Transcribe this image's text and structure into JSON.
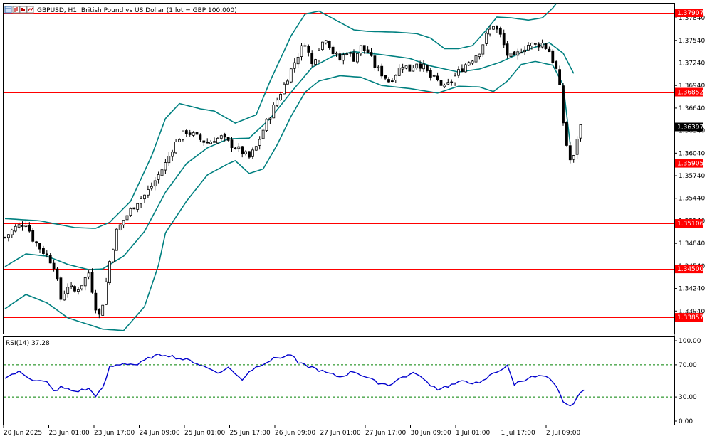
{
  "header": {
    "title": "GBPUSD, H1:  British Pound vs US Dollar (1 lot = GBP 100,000)",
    "icon_names": [
      "window-icon",
      "bars-icon",
      "candles-icon",
      "line-icon"
    ]
  },
  "indicator": {
    "label": "RSI(14) 37.28",
    "value": 37.28
  },
  "colors": {
    "candle": "#000000",
    "bollinger": "#008080",
    "level_line": "#ff0000",
    "level_tag": "#ff0000",
    "current_line": "#000000",
    "current_tag": "#000000",
    "rsi_line": "#0000cd",
    "rsi_levels": "#008000",
    "grid_frame": "#000000"
  },
  "chart_data": {
    "type": "candlestick",
    "symbol": "GBPUSD",
    "timeframe": "H1",
    "price_axis_ticks": [
      "1.37840",
      "1.37540",
      "1.37240",
      "1.36940",
      "1.36640",
      "1.36340",
      "1.36040",
      "1.35740",
      "1.35440",
      "1.35140",
      "1.34840",
      "1.34540",
      "1.34240",
      "1.33940"
    ],
    "ylim": [
      1.3364,
      1.3803
    ],
    "horizontal_levels": [
      {
        "label": "1.37907",
        "value": 1.37907
      },
      {
        "label": "1.36852",
        "value": 1.36852
      },
      {
        "label": "1.35905",
        "value": 1.35905
      },
      {
        "label": "1.35106",
        "value": 1.35106
      },
      {
        "label": "1.34500",
        "value": 1.345
      },
      {
        "label": "1.33857",
        "value": 1.33857
      }
    ],
    "current_price": {
      "label": "1.36397",
      "value": 1.36397
    },
    "time_labels": [
      "20 Jun 2025",
      "23 Jun 01:00",
      "23 Jun 17:00",
      "24 Jun 09:00",
      "25 Jun 01:00",
      "25 Jun 17:00",
      "26 Jun 09:00",
      "27 Jun 01:00",
      "27 Jun 17:00",
      "30 Jun 09:00",
      "1 Jul 01:00",
      "1 Jul 17:00",
      "2 Jul 09:00"
    ],
    "close_path": [
      [
        0,
        1.3492
      ],
      [
        3,
        1.3505
      ],
      [
        6,
        1.3512
      ],
      [
        8,
        1.349
      ],
      [
        10,
        1.3478
      ],
      [
        12,
        1.3468
      ],
      [
        14,
        1.3455
      ],
      [
        16,
        1.341
      ],
      [
        18,
        1.3428
      ],
      [
        20,
        1.342
      ],
      [
        22,
        1.343
      ],
      [
        24,
        1.3445
      ],
      [
        26,
        1.34
      ],
      [
        27,
        1.3388
      ],
      [
        28,
        1.3405
      ],
      [
        30,
        1.346
      ],
      [
        32,
        1.35
      ],
      [
        34,
        1.3515
      ],
      [
        36,
        1.3528
      ],
      [
        38,
        1.354
      ],
      [
        40,
        1.3548
      ],
      [
        42,
        1.356
      ],
      [
        44,
        1.3575
      ],
      [
        46,
        1.359
      ],
      [
        48,
        1.361
      ],
      [
        50,
        1.3625
      ],
      [
        52,
        1.3633
      ],
      [
        54,
        1.3628
      ],
      [
        56,
        1.3622
      ],
      [
        58,
        1.3618
      ],
      [
        60,
        1.3622
      ],
      [
        62,
        1.3625
      ],
      [
        64,
        1.3618
      ],
      [
        66,
        1.3612
      ],
      [
        68,
        1.3605
      ],
      [
        70,
        1.3598
      ],
      [
        72,
        1.3612
      ],
      [
        74,
        1.3635
      ],
      [
        76,
        1.3655
      ],
      [
        78,
        1.3675
      ],
      [
        80,
        1.3695
      ],
      [
        82,
        1.3715
      ],
      [
        84,
        1.3735
      ],
      [
        86,
        1.3752
      ],
      [
        88,
        1.3722
      ],
      [
        90,
        1.3745
      ],
      [
        92,
        1.3758
      ],
      [
        94,
        1.3738
      ],
      [
        96,
        1.3728
      ],
      [
        98,
        1.374
      ],
      [
        100,
        1.373
      ],
      [
        102,
        1.3745
      ],
      [
        104,
        1.3738
      ],
      [
        106,
        1.372
      ],
      [
        108,
        1.371
      ],
      [
        110,
        1.37
      ],
      [
        112,
        1.371
      ],
      [
        114,
        1.3722
      ],
      [
        116,
        1.3715
      ],
      [
        118,
        1.3725
      ],
      [
        120,
        1.3718
      ],
      [
        122,
        1.3705
      ],
      [
        124,
        1.37
      ],
      [
        126,
        1.369
      ],
      [
        128,
        1.37
      ],
      [
        130,
        1.3712
      ],
      [
        132,
        1.3722
      ],
      [
        134,
        1.373
      ],
      [
        136,
        1.374
      ],
      [
        138,
        1.376
      ],
      [
        140,
        1.3775
      ],
      [
        142,
        1.376
      ],
      [
        144,
        1.3735
      ],
      [
        146,
        1.373
      ],
      [
        148,
        1.3742
      ],
      [
        150,
        1.3748
      ],
      [
        152,
        1.3748
      ],
      [
        154,
        1.375
      ],
      [
        156,
        1.374
      ],
      [
        158,
        1.3715
      ],
      [
        159,
        1.369
      ],
      [
        160,
        1.3645
      ],
      [
        161,
        1.3615
      ],
      [
        162,
        1.3595
      ],
      [
        163,
        1.3598
      ],
      [
        164,
        1.3625
      ],
      [
        165,
        1.364
      ]
    ],
    "bollinger_bands": {
      "period_note": "upper / middle / lower bands",
      "upper": [
        [
          0,
          1.3517
        ],
        [
          10,
          1.3514
        ],
        [
          20,
          1.3505
        ],
        [
          26,
          1.3504
        ],
        [
          30,
          1.3512
        ],
        [
          36,
          1.354
        ],
        [
          42,
          1.36
        ],
        [
          46,
          1.365
        ],
        [
          50,
          1.367
        ],
        [
          56,
          1.3663
        ],
        [
          60,
          1.366
        ],
        [
          66,
          1.3644
        ],
        [
          72,
          1.3655
        ],
        [
          76,
          1.37
        ],
        [
          82,
          1.376
        ],
        [
          86,
          1.3789
        ],
        [
          90,
          1.3793
        ],
        [
          96,
          1.3778
        ],
        [
          100,
          1.3768
        ],
        [
          104,
          1.3766
        ],
        [
          112,
          1.3765
        ],
        [
          118,
          1.3763
        ],
        [
          122,
          1.3757
        ],
        [
          126,
          1.3743
        ],
        [
          130,
          1.3743
        ],
        [
          134,
          1.3747
        ],
        [
          138,
          1.3768
        ],
        [
          141,
          1.3785
        ],
        [
          145,
          1.3784
        ],
        [
          150,
          1.3781
        ],
        [
          154,
          1.3784
        ],
        [
          157,
          1.3797
        ],
        [
          158,
          1.381
        ]
      ],
      "middle": [
        [
          0,
          1.3453
        ],
        [
          6,
          1.347
        ],
        [
          12,
          1.3467
        ],
        [
          18,
          1.3456
        ],
        [
          24,
          1.3449
        ],
        [
          28,
          1.345
        ],
        [
          34,
          1.3467
        ],
        [
          40,
          1.35
        ],
        [
          46,
          1.3552
        ],
        [
          52,
          1.359
        ],
        [
          58,
          1.3611
        ],
        [
          64,
          1.3623
        ],
        [
          70,
          1.3624
        ],
        [
          76,
          1.365
        ],
        [
          82,
          1.3685
        ],
        [
          88,
          1.3718
        ],
        [
          94,
          1.3733
        ],
        [
          100,
          1.3739
        ],
        [
          108,
          1.3735
        ],
        [
          116,
          1.373
        ],
        [
          122,
          1.372
        ],
        [
          130,
          1.3712
        ],
        [
          136,
          1.3716
        ],
        [
          142,
          1.3725
        ],
        [
          150,
          1.3742
        ],
        [
          156,
          1.3751
        ],
        [
          160,
          1.3737
        ],
        [
          163,
          1.371
        ]
      ],
      "lower": [
        [
          0,
          1.3397
        ],
        [
          6,
          1.3416
        ],
        [
          12,
          1.3405
        ],
        [
          18,
          1.3385
        ],
        [
          24,
          1.3376
        ],
        [
          28,
          1.337
        ],
        [
          34,
          1.3368
        ],
        [
          40,
          1.34
        ],
        [
          44,
          1.3455
        ],
        [
          46,
          1.3498
        ],
        [
          52,
          1.354
        ],
        [
          58,
          1.3575
        ],
        [
          64,
          1.359
        ],
        [
          66,
          1.3594
        ],
        [
          70,
          1.3577
        ],
        [
          74,
          1.3583
        ],
        [
          78,
          1.3615
        ],
        [
          82,
          1.3653
        ],
        [
          86,
          1.3685
        ],
        [
          90,
          1.37
        ],
        [
          96,
          1.3707
        ],
        [
          102,
          1.3705
        ],
        [
          108,
          1.3694
        ],
        [
          116,
          1.369
        ],
        [
          124,
          1.3684
        ],
        [
          130,
          1.3693
        ],
        [
          136,
          1.3692
        ],
        [
          140,
          1.3686
        ],
        [
          144,
          1.37
        ],
        [
          148,
          1.3722
        ],
        [
          152,
          1.3726
        ],
        [
          157,
          1.3721
        ],
        [
          160,
          1.3695
        ],
        [
          162,
          1.3616
        ]
      ]
    },
    "rsi": {
      "ticks": [
        "100.00",
        "70.00",
        "30.00",
        "0.00"
      ],
      "levels": [
        70,
        30
      ],
      "ylim": [
        0,
        100
      ],
      "values": [
        [
          0,
          55
        ],
        [
          4,
          61
        ],
        [
          8,
          52
        ],
        [
          12,
          48
        ],
        [
          14,
          37
        ],
        [
          16,
          42
        ],
        [
          20,
          37
        ],
        [
          24,
          40
        ],
        [
          26,
          32
        ],
        [
          28,
          40
        ],
        [
          30,
          67
        ],
        [
          34,
          72
        ],
        [
          38,
          70
        ],
        [
          42,
          80
        ],
        [
          46,
          83
        ],
        [
          50,
          78
        ],
        [
          54,
          74
        ],
        [
          58,
          66
        ],
        [
          62,
          60
        ],
        [
          64,
          68
        ],
        [
          66,
          58
        ],
        [
          68,
          52
        ],
        [
          70,
          62
        ],
        [
          74,
          72
        ],
        [
          78,
          79
        ],
        [
          80,
          80
        ],
        [
          82,
          83
        ],
        [
          84,
          72
        ],
        [
          86,
          69
        ],
        [
          88,
          67
        ],
        [
          92,
          60
        ],
        [
          96,
          55
        ],
        [
          100,
          62
        ],
        [
          104,
          54
        ],
        [
          106,
          49
        ],
        [
          110,
          45
        ],
        [
          114,
          55
        ],
        [
          118,
          60
        ],
        [
          120,
          51
        ],
        [
          124,
          40
        ],
        [
          128,
          45
        ],
        [
          132,
          50
        ],
        [
          136,
          46
        ],
        [
          140,
          60
        ],
        [
          144,
          68
        ],
        [
          146,
          46
        ],
        [
          150,
          54
        ],
        [
          154,
          56
        ],
        [
          156,
          52
        ],
        [
          158,
          42
        ],
        [
          160,
          25
        ],
        [
          162,
          17
        ],
        [
          164,
          30
        ],
        [
          166,
          38
        ]
      ]
    }
  }
}
